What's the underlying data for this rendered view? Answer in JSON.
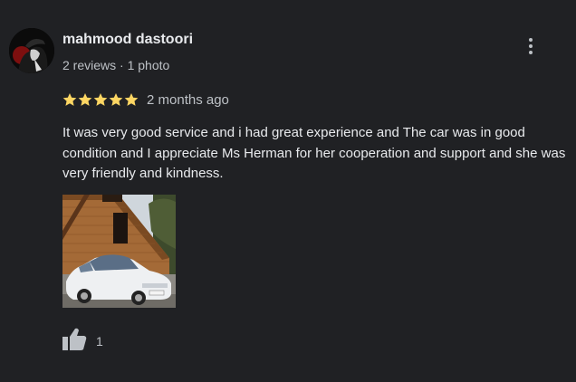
{
  "review": {
    "author": {
      "name": "mahmood dastoori",
      "meta": "2 reviews · 1 photo",
      "avatar_icon": "avatar-silhouette-icon"
    },
    "menu_icon": "more-vert-icon",
    "rating": {
      "stars": 5,
      "max": 5,
      "star_color": "#fdd663",
      "time": "2 months ago"
    },
    "text": "It was very good service and i had great experience and The car was in good condition and I appreciate Ms Herman for her cooperation and support and she was very friendly and kindness.",
    "photos": [
      {
        "description_icon": "photo-thumbnail-icon"
      }
    ],
    "like": {
      "icon": "thumb-up-icon",
      "count": "1"
    }
  }
}
